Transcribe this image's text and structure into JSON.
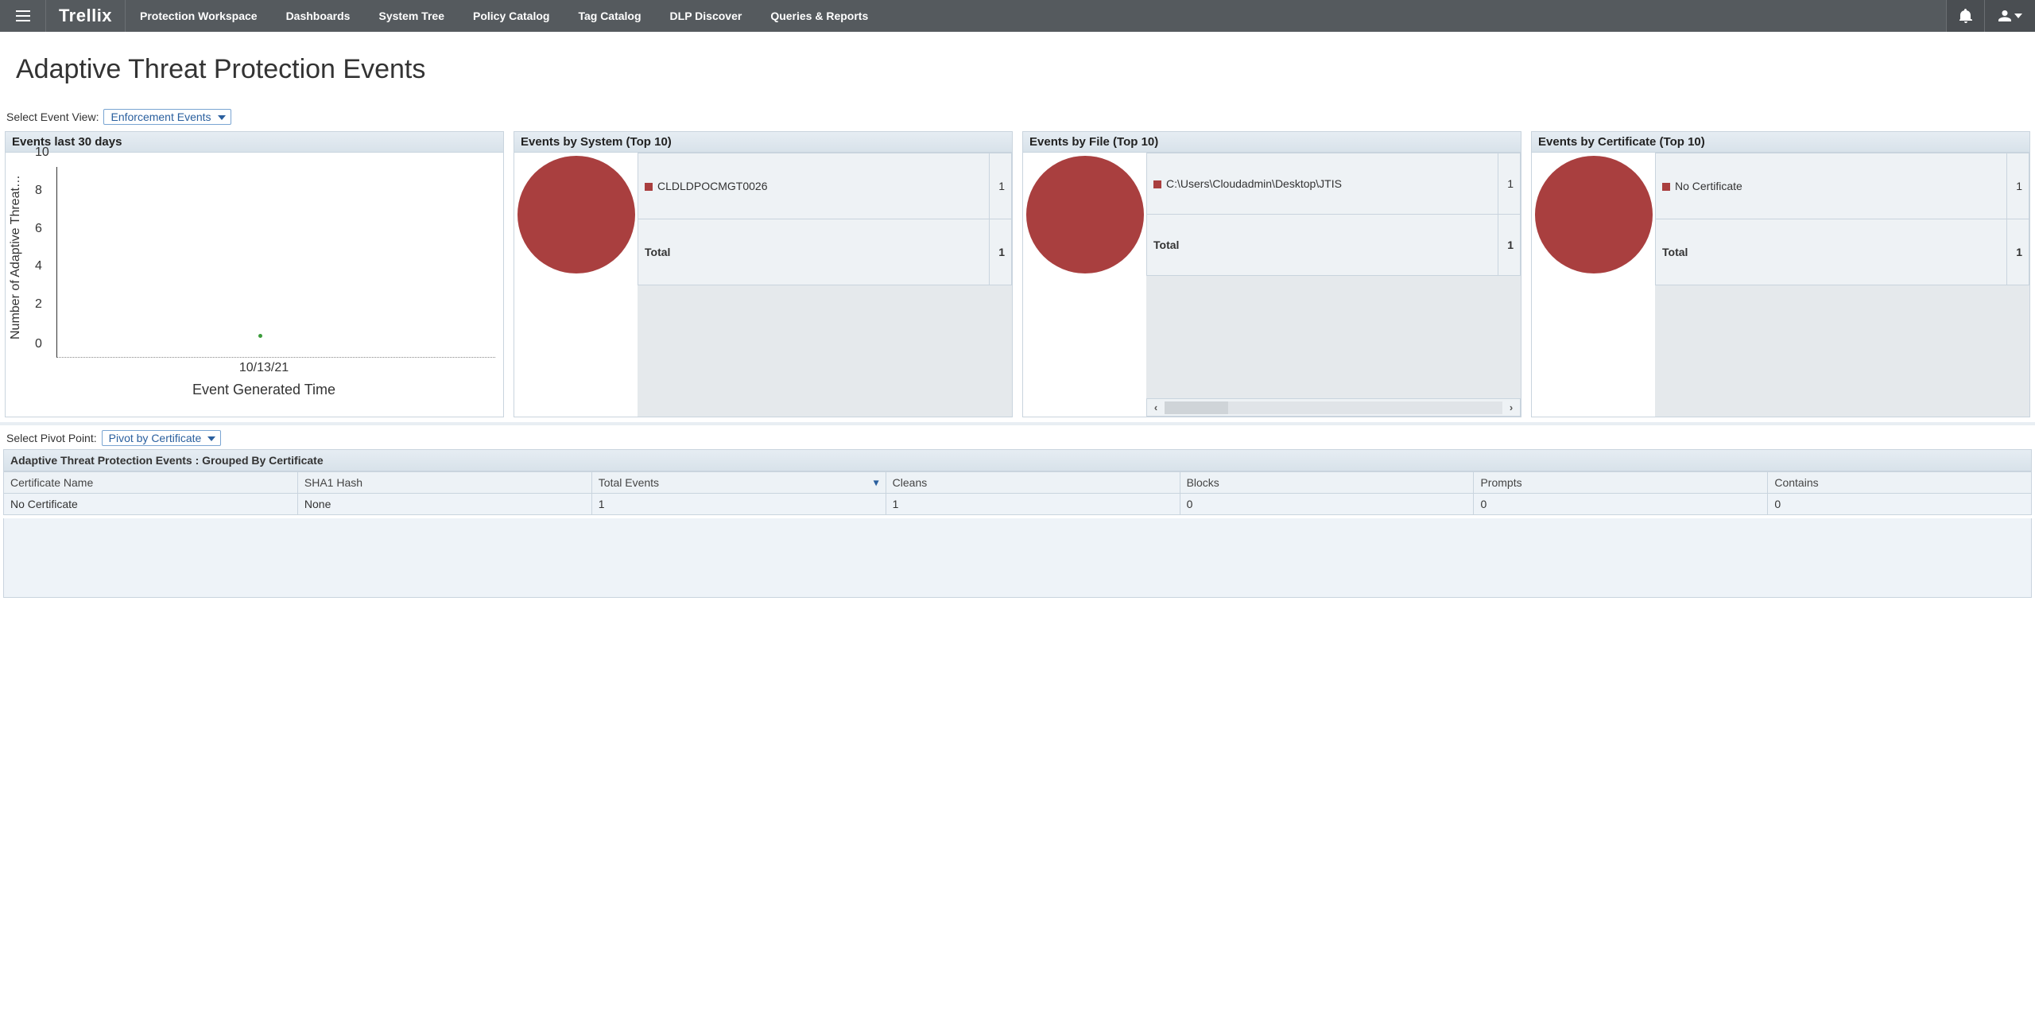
{
  "header": {
    "brand": "Trellix",
    "nav": [
      "Protection Workspace",
      "Dashboards",
      "System Tree",
      "Policy Catalog",
      "Tag Catalog",
      "DLP Discover",
      "Queries & Reports"
    ]
  },
  "page_title": "Adaptive Threat Protection Events",
  "event_view": {
    "label": "Select Event View:",
    "value": "Enforcement Events"
  },
  "pivot": {
    "label": "Select Pivot Point:",
    "value": "Pivot by Certificate"
  },
  "panels": {
    "p0": {
      "title": "Events last 30 days"
    },
    "p1": {
      "title": "Events by System (Top 10)",
      "item_label": "CLDLDPOCMGT0026",
      "item_count": "1",
      "total_label": "Total",
      "total_count": "1"
    },
    "p2": {
      "title": "Events by File (Top 10)",
      "item_label": "C:\\Users\\Cloudadmin\\Desktop\\JTIS",
      "item_count": "1",
      "total_label": "Total",
      "total_count": "1"
    },
    "p3": {
      "title": "Events by Certificate (Top 10)",
      "item_label": "No Certificate",
      "item_count": "1",
      "total_label": "Total",
      "total_count": "1"
    }
  },
  "chart_data": {
    "type": "scatter",
    "ylabel": "Number of Adaptive Threat…",
    "xlabel": "Event Generated Time",
    "yticks": [
      "0",
      "2",
      "4",
      "6",
      "8",
      "10"
    ],
    "xtick": "10/13/21",
    "point_value": 1
  },
  "grouped": {
    "title": "Adaptive Threat Protection Events : Grouped By Certificate",
    "cols": [
      "Certificate Name",
      "SHA1 Hash",
      "Total Events",
      "Cleans",
      "Blocks",
      "Prompts",
      "Contains"
    ],
    "row": [
      "No Certificate",
      "None",
      "1",
      "1",
      "0",
      "0",
      "0"
    ]
  }
}
